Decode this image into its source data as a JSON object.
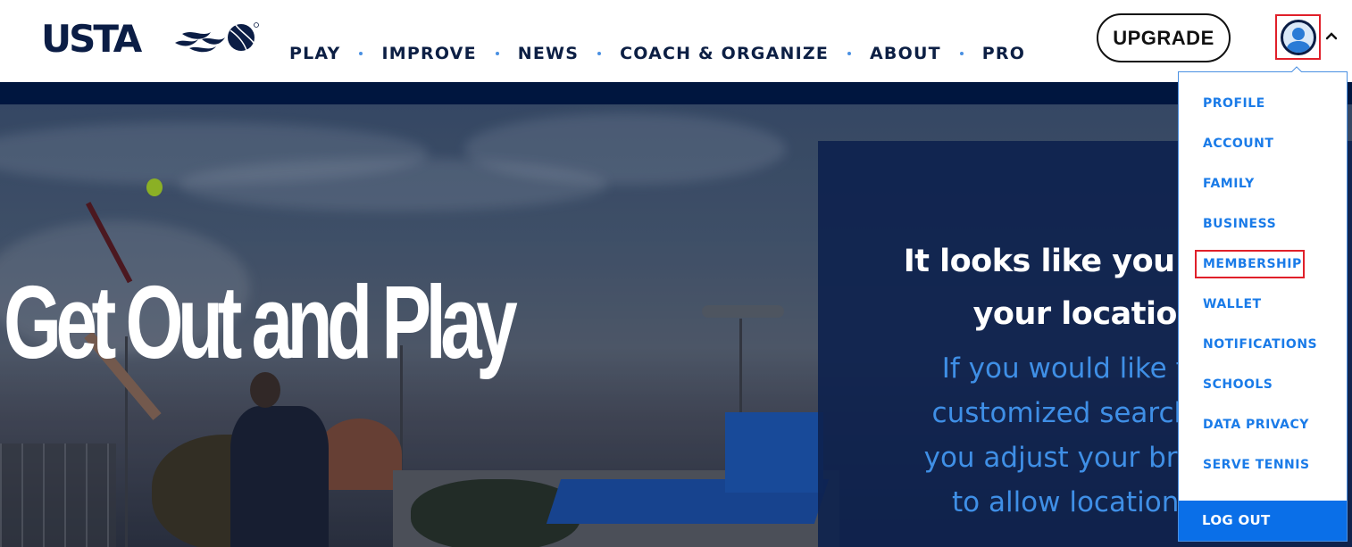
{
  "header": {
    "logo_text": "USTA",
    "nav": [
      {
        "label": "PLAY"
      },
      {
        "label": "IMPROVE"
      },
      {
        "label": "NEWS"
      },
      {
        "label": "COACH & ORGANIZE"
      },
      {
        "label": "ABOUT"
      },
      {
        "label": "PRO"
      }
    ],
    "upgrade_label": "UPGRADE",
    "avatar_icon": "user-avatar-icon",
    "menu_toggle_icon": "chevron-up-icon"
  },
  "hero": {
    "title": "Get Out and Play"
  },
  "location_card": {
    "heading_lines": [
      "It looks like you have",
      "your location"
    ],
    "body_lines": [
      "If you would like to u",
      "customized search we",
      "you adjust your browse",
      "to allow location sh"
    ]
  },
  "user_menu": {
    "items": [
      {
        "label": "PROFILE"
      },
      {
        "label": "ACCOUNT"
      },
      {
        "label": "FAMILY"
      },
      {
        "label": "BUSINESS"
      },
      {
        "label": "MEMBERSHIP",
        "highlighted": true
      },
      {
        "label": "WALLET"
      },
      {
        "label": "NOTIFICATIONS"
      },
      {
        "label": "SCHOOLS"
      },
      {
        "label": "DATA PRIVACY"
      },
      {
        "label": "SERVE TENNIS"
      }
    ],
    "logout_label": "LOG OUT"
  },
  "colors": {
    "brand_navy": "#0c1f44",
    "menu_link": "#1a7be8",
    "logout_bg": "#0a6fe8",
    "highlight_box": "#e0202a"
  }
}
